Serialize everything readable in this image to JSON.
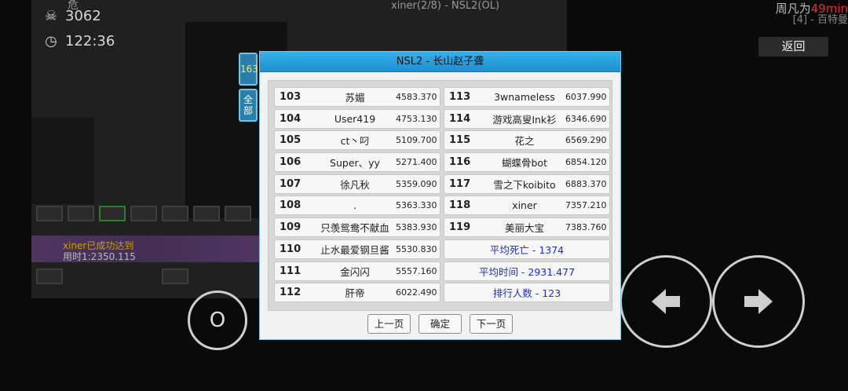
{
  "hud": {
    "top_left": "危",
    "deaths": "3062",
    "time": "122:36",
    "room_title": "xiner(2/8) - NSL2(OL)",
    "top_right_prefix": "周凡为",
    "top_right_highlight": "49min",
    "top_right_line2": "[4] - 百特曼",
    "back_label": "返回",
    "game_message_line1": "xiner已成功达到",
    "game_message_line2": "用时1:2350.115"
  },
  "side_tabs": [
    {
      "label": "163",
      "active": true
    },
    {
      "label": "全部",
      "active": false
    }
  ],
  "dialog": {
    "title": "NSL2 - 长山赵子聋",
    "left_rows": [
      {
        "rank": "103",
        "name": "苏媚",
        "time": "4583.370"
      },
      {
        "rank": "104",
        "name": "User419",
        "time": "4753.130"
      },
      {
        "rank": "105",
        "name": "ct丶叼",
        "time": "5109.700"
      },
      {
        "rank": "106",
        "name": "Super、yy",
        "time": "5271.400"
      },
      {
        "rank": "107",
        "name": "徐凡秋",
        "time": "5359.090"
      },
      {
        "rank": "108",
        "name": ".",
        "time": "5363.330"
      },
      {
        "rank": "109",
        "name": "只羡鸳鸯不献血",
        "time": "5383.930"
      },
      {
        "rank": "110",
        "name": "止水最爱钢旦酱",
        "time": "5530.830"
      },
      {
        "rank": "111",
        "name": "金闪闪",
        "time": "5557.160"
      },
      {
        "rank": "112",
        "name": "肝帝",
        "time": "6022.490"
      }
    ],
    "right_rows": [
      {
        "rank": "113",
        "name": "3wnameless",
        "time": "6037.990"
      },
      {
        "rank": "114",
        "name": "游戏高叟Ink衫",
        "time": "6346.690"
      },
      {
        "rank": "115",
        "name": "花之",
        "time": "6569.290"
      },
      {
        "rank": "116",
        "name": "蝴蝶骨bot",
        "time": "6854.120"
      },
      {
        "rank": "117",
        "name": "雪之下koibito",
        "time": "6883.370"
      },
      {
        "rank": "118",
        "name": "xiner",
        "time": "7357.210"
      },
      {
        "rank": "119",
        "name": "美丽大宝",
        "time": "7383.760"
      }
    ],
    "stats": [
      "平均死亡 - 1374",
      "平均时间 - 2931.477",
      "排行人数 - 123"
    ],
    "buttons": {
      "prev": "上一页",
      "ok": "确定",
      "next": "下一页"
    }
  },
  "controls": {
    "jump_label": "O"
  }
}
